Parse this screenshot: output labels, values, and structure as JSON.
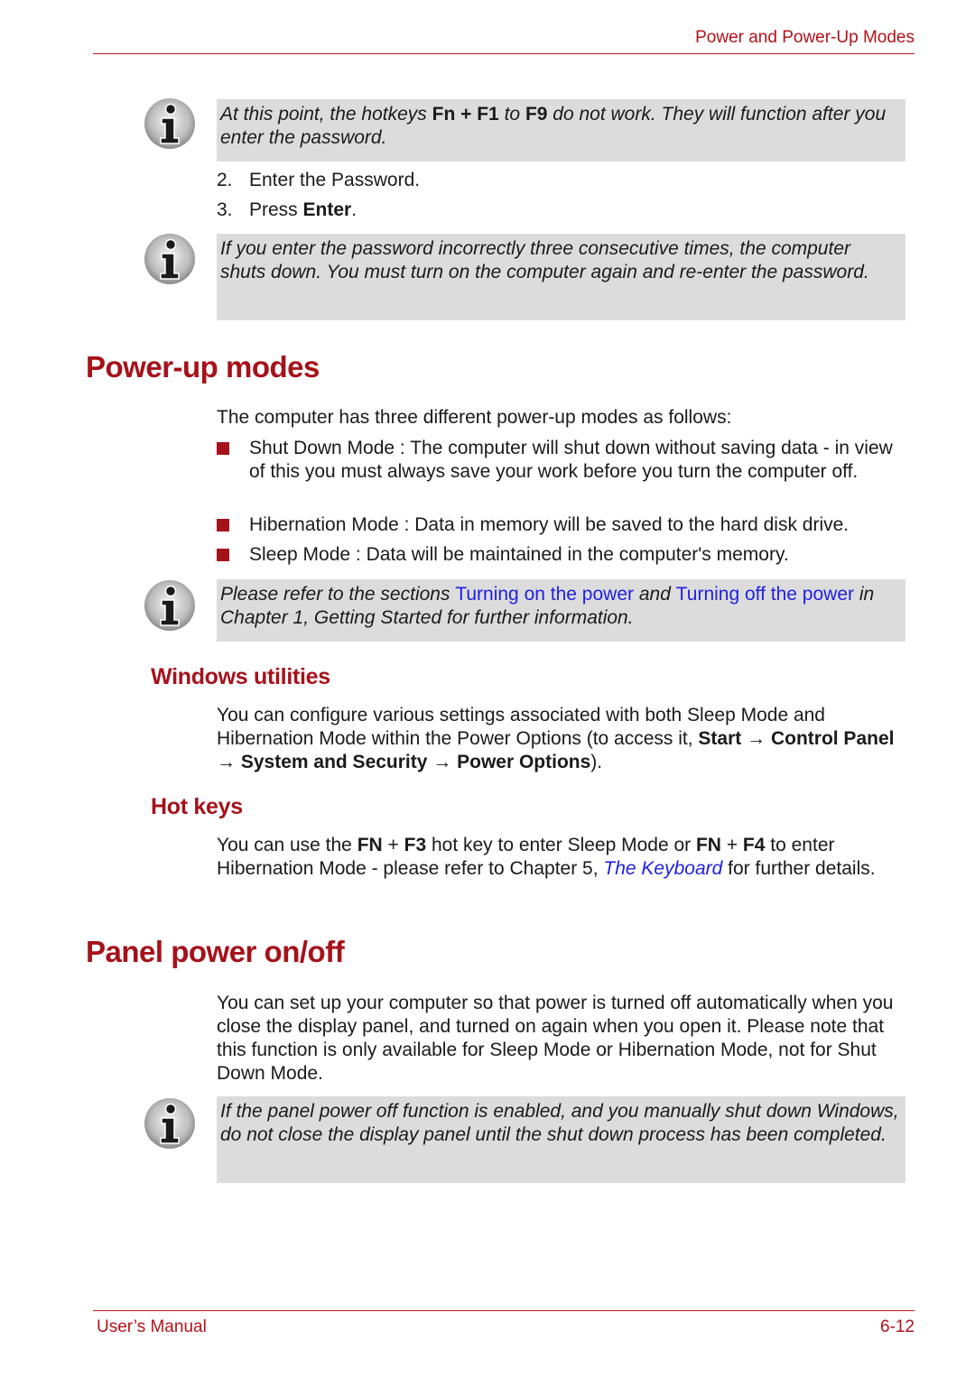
{
  "header": {
    "title": "Power and Power-Up Modes"
  },
  "notes": [
    {
      "parts": [
        {
          "t": "At this point, the hotkeys ",
          "s": "i"
        },
        {
          "t": "Fn + F1",
          "s": "b"
        },
        {
          "t": " to ",
          "s": "i"
        },
        {
          "t": "F9",
          "s": "b"
        },
        {
          "t": " do not work. They will function after you enter the password.",
          "s": "i"
        }
      ]
    },
    {
      "parts": [
        {
          "t": "If you enter the password incorrectly three consecutive times, the computer shuts down. You must turn on the computer again and re-enter the password.",
          "s": "i"
        }
      ]
    },
    {
      "parts": [
        {
          "t": "Please refer to the sections ",
          "s": "i"
        },
        {
          "t": "Turning on the power",
          "s": "link"
        },
        {
          "t": " and ",
          "s": "i"
        },
        {
          "t": "Turning off the power",
          "s": "link"
        },
        {
          "t": " in Chapter 1, Getting Started for further information.",
          "s": "i"
        }
      ]
    },
    {
      "parts": [
        {
          "t": "If the panel power off function is enabled, and you manually shut down Windows, do not close the display panel until the shut down process has been completed.",
          "s": "i"
        }
      ]
    }
  ],
  "steps": [
    {
      "num": "2.",
      "text": "Enter the Password.",
      "bold": ""
    },
    {
      "num": "3.",
      "text": "Press ",
      "bold": "Enter",
      "after": "."
    }
  ],
  "sections": {
    "power_up": {
      "title": "Power-up modes",
      "intro": "The computer has three different power-up modes as follows:",
      "bullets": [
        "Shut Down Mode : The computer will shut down without saving data - in view of this you must always save your work before you turn the computer off.",
        "Hibernation Mode : Data in memory will be saved to the hard disk drive.",
        "Sleep Mode : Data will be maintained in the computer's memory."
      ]
    },
    "windows_utilities": {
      "title": "Windows utilities",
      "parts": [
        {
          "t": "You can configure various settings associated with both Sleep Mode and Hibernation Mode within the Power Options (to access it, ",
          "s": "n"
        },
        {
          "t": "Start",
          "s": "b"
        },
        {
          "t": " → ",
          "s": "n"
        },
        {
          "t": "Control Panel",
          "s": "b"
        },
        {
          "t": " → ",
          "s": "n"
        },
        {
          "t": "System and Security",
          "s": "b"
        },
        {
          "t": " → ",
          "s": "n"
        },
        {
          "t": "Power Options",
          "s": "b"
        },
        {
          "t": ").",
          "s": "n"
        }
      ]
    },
    "hot_keys": {
      "title": "Hot keys",
      "parts": [
        {
          "t": "You can use the ",
          "s": "n"
        },
        {
          "t": "FN",
          "s": "b"
        },
        {
          "t": " + ",
          "s": "n"
        },
        {
          "t": "F3",
          "s": "b"
        },
        {
          "t": " hot key to enter Sleep Mode or ",
          "s": "n"
        },
        {
          "t": "FN",
          "s": "b"
        },
        {
          "t": " + ",
          "s": "n"
        },
        {
          "t": "F4",
          "s": "b"
        },
        {
          "t": " to enter Hibernation Mode - please refer to Chapter 5, ",
          "s": "n"
        },
        {
          "t": "The Keyboard",
          "s": "link"
        },
        {
          "t": " for further details.",
          "s": "n"
        }
      ]
    },
    "panel_power": {
      "title": "Panel power on/off",
      "text": "You can set up your computer so that power is turned off automatically when you close the display panel, and turned on again when you open it. Please note that this function is only available for Sleep Mode or Hibernation Mode, not for Shut Down Mode."
    }
  },
  "footer": {
    "left": "User’s Manual",
    "right": "6-12"
  },
  "colors": {
    "accent": "#a5121a",
    "note_bg": "#dcdcdc",
    "link": "#1f1fe0"
  }
}
